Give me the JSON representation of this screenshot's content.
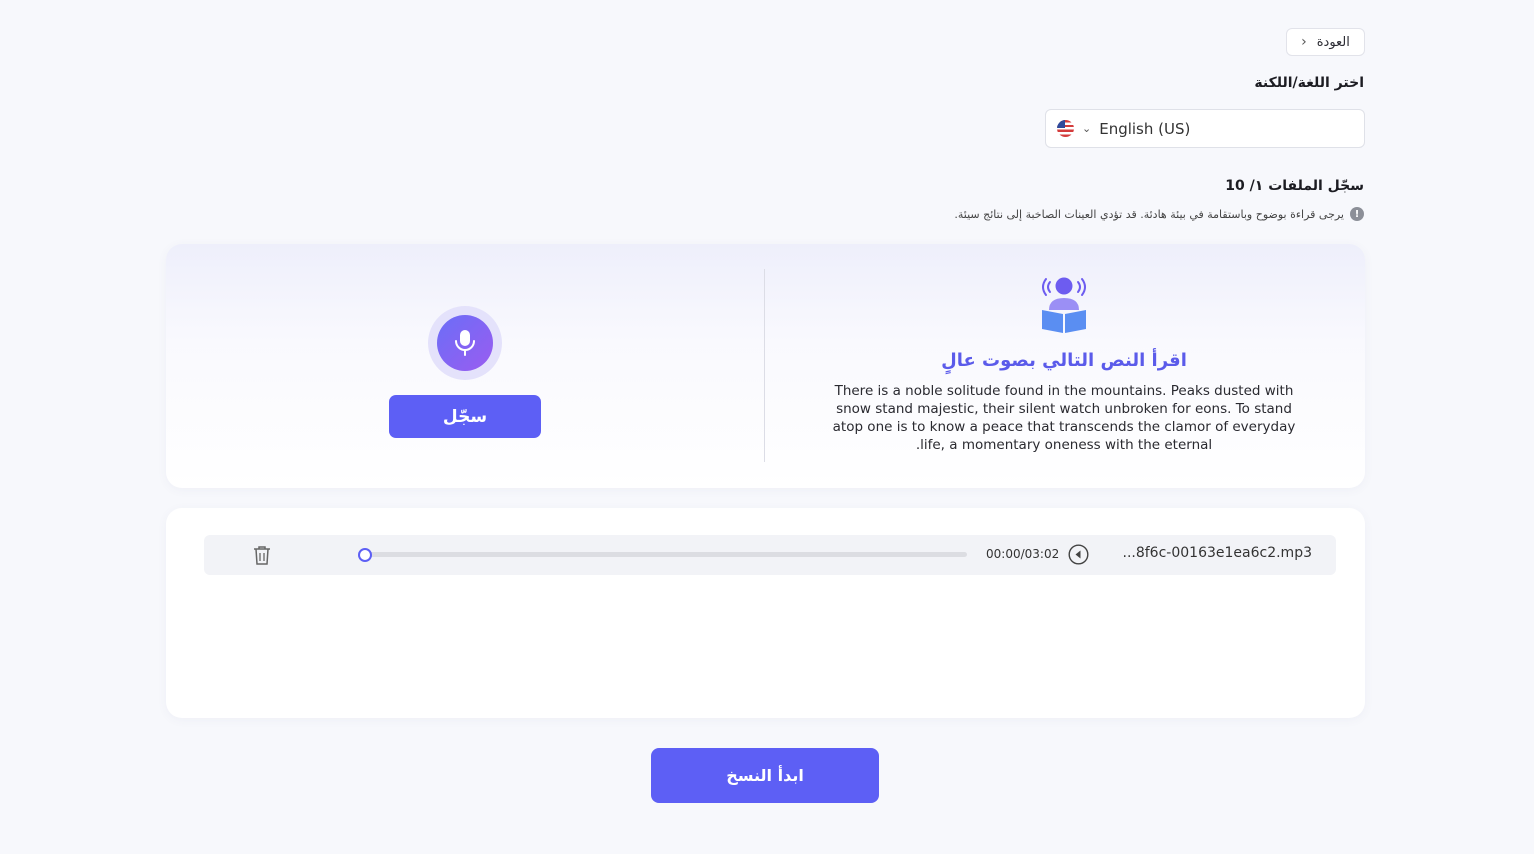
{
  "header": {
    "back_label": "العودة"
  },
  "language": {
    "label": "اختر اللغة/اللكنة",
    "selected": "English (US)"
  },
  "files": {
    "label": "سجّل الملفات ١/ 10",
    "hint": "يرجى قراءة بوضوح وباستقامة في بيئة هادئة. قد تؤدي العينات الصاخبة إلى نتائج سيئة."
  },
  "reader": {
    "title": "اقرأ النص التالي بصوت عالٍ",
    "text": "There is a noble solitude found in the mountains. Peaks dusted with snow stand majestic, their silent watch unbroken for eons. To stand atop one is to know a peace that transcends the clamor of everyday life, a momentary oneness with the eternal."
  },
  "recorder": {
    "record_label": "سجّل"
  },
  "recordings": [
    {
      "filename": "...8f6c-00163e1ea6c2.mp3",
      "time": "00:00/03:02",
      "progress": 0
    }
  ],
  "actions": {
    "start_label": "ابدأ النسخ"
  },
  "colors": {
    "accent": "#5d5ff5",
    "title": "#5b5bea"
  }
}
